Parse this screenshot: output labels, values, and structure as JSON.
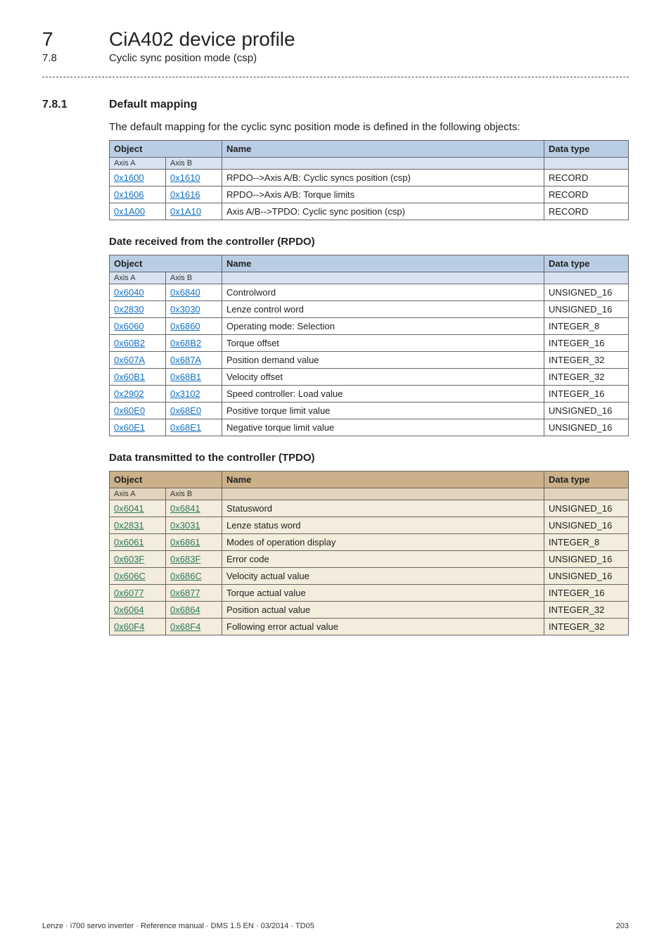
{
  "chapter": {
    "num": "7",
    "title": "CiA402 device profile"
  },
  "subsection": {
    "num": "7.8",
    "title": "Cyclic sync position mode (csp)"
  },
  "section": {
    "num": "7.8.1",
    "title": "Default mapping"
  },
  "intro": "The default mapping for the cyclic sync position mode is defined in the following objects:",
  "headers": {
    "object": "Object",
    "name": "Name",
    "data_type": "Data type",
    "axis_a": "Axis A",
    "axis_b": "Axis B"
  },
  "mapping_rows": [
    {
      "a": "0x1600",
      "b": "0x1610",
      "name": "RPDO-->Axis A/B: Cyclic syncs position (csp)",
      "type": "RECORD"
    },
    {
      "a": "0x1606",
      "b": "0x1616",
      "name": "RPDO-->Axis A/B: Torque limits",
      "type": "RECORD"
    },
    {
      "a": "0x1A00",
      "b": "0x1A10",
      "name": "Axis A/B-->TPDO: Cyclic sync position (csp)",
      "type": "RECORD"
    }
  ],
  "rpdo_heading": "Date received from the controller (RPDO)",
  "rpdo_rows": [
    {
      "a": "0x6040",
      "b": "0x6840",
      "name": "Controlword",
      "type": "UNSIGNED_16"
    },
    {
      "a": "0x2830",
      "b": "0x3030",
      "name": "Lenze control word",
      "type": "UNSIGNED_16"
    },
    {
      "a": "0x6060",
      "b": "0x6860",
      "name": "Operating mode: Selection",
      "type": "INTEGER_8"
    },
    {
      "a": "0x60B2",
      "b": "0x68B2",
      "name": "Torque offset",
      "type": "INTEGER_16"
    },
    {
      "a": "0x607A",
      "b": "0x687A",
      "name": "Position demand value",
      "type": "INTEGER_32"
    },
    {
      "a": "0x60B1",
      "b": "0x68B1",
      "name": "Velocity offset",
      "type": "INTEGER_32"
    },
    {
      "a": "0x2902",
      "b": "0x3102",
      "name": "Speed controller: Load value",
      "type": "INTEGER_16"
    },
    {
      "a": "0x60E0",
      "b": "0x68E0",
      "name": "Positive torque limit value",
      "type": "UNSIGNED_16"
    },
    {
      "a": "0x60E1",
      "b": "0x68E1",
      "name": "Negative torque limit value",
      "type": "UNSIGNED_16"
    }
  ],
  "tpdo_heading": "Data transmitted to the controller (TPDO)",
  "tpdo_rows": [
    {
      "a": "0x6041",
      "b": "0x6841",
      "name": "Statusword",
      "type": "UNSIGNED_16"
    },
    {
      "a": "0x2831",
      "b": "0x3031",
      "name": "Lenze status word",
      "type": "UNSIGNED_16"
    },
    {
      "a": "0x6061",
      "b": "0x6861",
      "name": "Modes of operation display",
      "type": "INTEGER_8"
    },
    {
      "a": "0x603F",
      "b": "0x683F",
      "name": "Error code",
      "type": "UNSIGNED_16"
    },
    {
      "a": "0x606C",
      "b": "0x686C",
      "name": "Velocity actual value",
      "type": "UNSIGNED_16"
    },
    {
      "a": "0x6077",
      "b": "0x6877",
      "name": "Torque actual value",
      "type": "INTEGER_16"
    },
    {
      "a": "0x6064",
      "b": "0x6864",
      "name": "Position actual value",
      "type": "INTEGER_32"
    },
    {
      "a": "0x60F4",
      "b": "0x68F4",
      "name": "Following error actual value",
      "type": "INTEGER_32"
    }
  ],
  "footer": {
    "left": "Lenze · i700 servo inverter · Reference manual · DMS 1.5 EN · 03/2014 · TD05",
    "right": "203"
  }
}
